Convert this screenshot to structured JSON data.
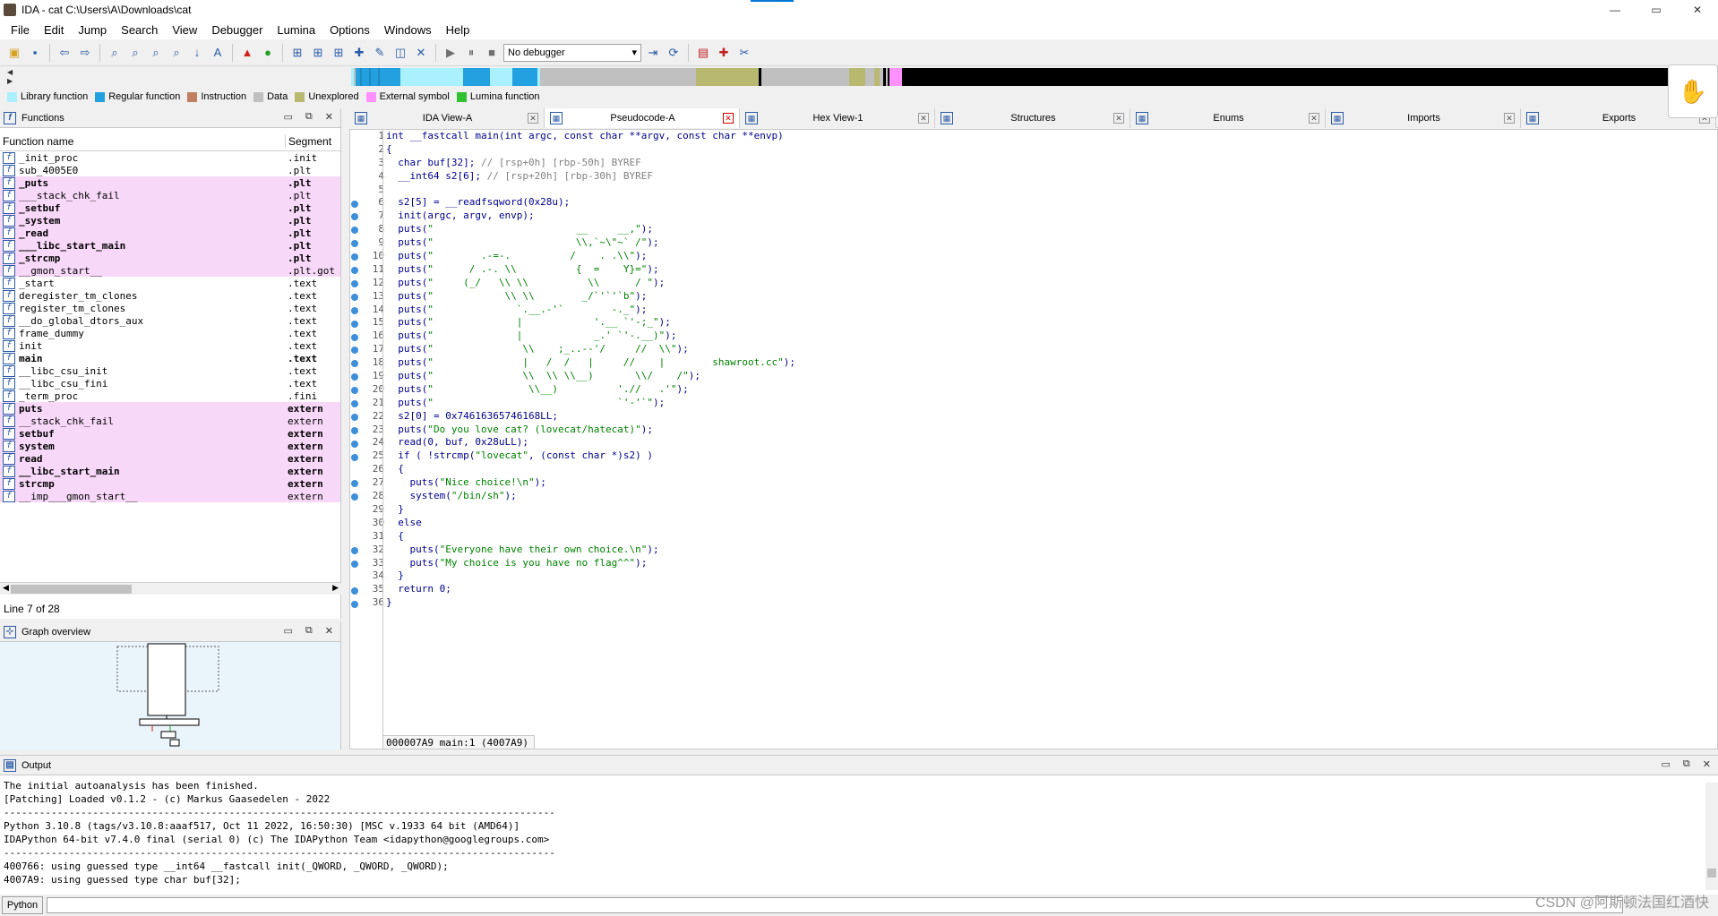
{
  "window": {
    "title": "IDA - cat C:\\Users\\A\\Downloads\\cat",
    "min": "—",
    "max": "▭",
    "close": "✕"
  },
  "menu": [
    "File",
    "Edit",
    "Jump",
    "Search",
    "View",
    "Debugger",
    "Lumina",
    "Options",
    "Windows",
    "Help"
  ],
  "toolbar": {
    "debugger_select": "No debugger"
  },
  "legend": [
    {
      "label": "Library function",
      "color": "#aaf0ff"
    },
    {
      "label": "Regular function",
      "color": "#22a0e0"
    },
    {
      "label": "Instruction",
      "color": "#c08060"
    },
    {
      "label": "Data",
      "color": "#c0c0c0"
    },
    {
      "label": "Unexplored",
      "color": "#b8b870"
    },
    {
      "label": "External symbol",
      "color": "#ff90ff"
    },
    {
      "label": "Lumina function",
      "color": "#30c030"
    }
  ],
  "functions_panel": {
    "title": "Functions",
    "col_name": "Function name",
    "col_segment": "Segment",
    "status": "Line 7 of 28",
    "rows": [
      {
        "name": "_init_proc",
        "seg": ".init",
        "lib": false,
        "bold": false
      },
      {
        "name": "sub_4005E0",
        "seg": ".plt",
        "lib": false,
        "bold": false
      },
      {
        "name": "_puts",
        "seg": ".plt",
        "lib": true,
        "bold": true
      },
      {
        "name": "___stack_chk_fail",
        "seg": ".plt",
        "lib": true,
        "bold": false
      },
      {
        "name": "_setbuf",
        "seg": ".plt",
        "lib": true,
        "bold": true
      },
      {
        "name": "_system",
        "seg": ".plt",
        "lib": true,
        "bold": true
      },
      {
        "name": "_read",
        "seg": ".plt",
        "lib": true,
        "bold": true
      },
      {
        "name": "___libc_start_main",
        "seg": ".plt",
        "lib": true,
        "bold": true
      },
      {
        "name": "_strcmp",
        "seg": ".plt",
        "lib": true,
        "bold": true
      },
      {
        "name": "__gmon_start__",
        "seg": ".plt.got",
        "lib": true,
        "bold": false
      },
      {
        "name": "_start",
        "seg": ".text",
        "lib": false,
        "bold": false
      },
      {
        "name": "deregister_tm_clones",
        "seg": ".text",
        "lib": false,
        "bold": false
      },
      {
        "name": "register_tm_clones",
        "seg": ".text",
        "lib": false,
        "bold": false
      },
      {
        "name": "__do_global_dtors_aux",
        "seg": ".text",
        "lib": false,
        "bold": false
      },
      {
        "name": "frame_dummy",
        "seg": ".text",
        "lib": false,
        "bold": false
      },
      {
        "name": "init",
        "seg": ".text",
        "lib": false,
        "bold": false
      },
      {
        "name": "main",
        "seg": ".text",
        "lib": false,
        "bold": true
      },
      {
        "name": "__libc_csu_init",
        "seg": ".text",
        "lib": false,
        "bold": false
      },
      {
        "name": "__libc_csu_fini",
        "seg": ".text",
        "lib": false,
        "bold": false
      },
      {
        "name": "_term_proc",
        "seg": ".fini",
        "lib": false,
        "bold": false
      },
      {
        "name": "puts",
        "seg": "extern",
        "lib": true,
        "bold": true
      },
      {
        "name": "__stack_chk_fail",
        "seg": "extern",
        "lib": true,
        "bold": false
      },
      {
        "name": "setbuf",
        "seg": "extern",
        "lib": true,
        "bold": true
      },
      {
        "name": "system",
        "seg": "extern",
        "lib": true,
        "bold": true
      },
      {
        "name": "read",
        "seg": "extern",
        "lib": true,
        "bold": true
      },
      {
        "name": "__libc_start_main",
        "seg": "extern",
        "lib": true,
        "bold": true
      },
      {
        "name": "strcmp",
        "seg": "extern",
        "lib": true,
        "bold": true
      },
      {
        "name": "__imp___gmon_start__",
        "seg": "extern",
        "lib": true,
        "bold": false
      }
    ]
  },
  "graph_panel": {
    "title": "Graph overview"
  },
  "tabs": [
    {
      "label": "IDA View-A",
      "icon": "ida-view-icon",
      "active": false
    },
    {
      "label": "Pseudocode-A",
      "icon": "pseudocode-icon",
      "active": true
    },
    {
      "label": "Hex View-1",
      "icon": "hex-view-icon",
      "active": false
    },
    {
      "label": "Structures",
      "icon": "structures-icon",
      "active": false
    },
    {
      "label": "Enums",
      "icon": "enums-icon",
      "active": false
    },
    {
      "label": "Imports",
      "icon": "imports-icon",
      "active": false
    },
    {
      "label": "Exports",
      "icon": "exports-icon",
      "active": false
    }
  ],
  "code": {
    "status": "000007A9 main:1 (4007A9)",
    "lines": [
      {
        "n": "1",
        "dot": false,
        "parts": [
          [
            "t",
            "int __fastcall main(int argc, const char **argv, const char **envp)"
          ]
        ]
      },
      {
        "n": "2",
        "dot": false,
        "parts": [
          [
            "t",
            "{"
          ]
        ]
      },
      {
        "n": "3",
        "dot": false,
        "parts": [
          [
            "t",
            "  char buf[32]; "
          ],
          [
            "g",
            "// [rsp+0h] [rbp-50h] BYREF"
          ]
        ]
      },
      {
        "n": "4",
        "dot": false,
        "parts": [
          [
            "t",
            "  __int64 s2[6]; "
          ],
          [
            "g",
            "// [rsp+20h] [rbp-30h] BYREF"
          ]
        ]
      },
      {
        "n": "5",
        "dot": false,
        "parts": [
          [
            "t",
            ""
          ]
        ]
      },
      {
        "n": "6",
        "dot": true,
        "parts": [
          [
            "t",
            "  s2[5] = __readfsqword(0x28u);"
          ]
        ]
      },
      {
        "n": "7",
        "dot": true,
        "parts": [
          [
            "t",
            "  init(argc, argv, envp);"
          ]
        ]
      },
      {
        "n": "8",
        "dot": true,
        "parts": [
          [
            "t",
            "  puts("
          ],
          [
            "s",
            "\"                        __     __,\""
          ],
          [
            "t",
            ");"
          ]
        ]
      },
      {
        "n": "9",
        "dot": true,
        "parts": [
          [
            "t",
            "  puts("
          ],
          [
            "s",
            "\"                        \\\\,`~\\\"~` /\""
          ],
          [
            "t",
            ");"
          ]
        ]
      },
      {
        "n": "10",
        "dot": true,
        "parts": [
          [
            "t",
            "  puts("
          ],
          [
            "s",
            "\"        .-=-.          /    . .\\\\\""
          ],
          [
            "t",
            ");"
          ]
        ]
      },
      {
        "n": "11",
        "dot": true,
        "parts": [
          [
            "t",
            "  puts("
          ],
          [
            "s",
            "\"      / .-. \\\\          {  =    Y}=\""
          ],
          [
            "t",
            ");"
          ]
        ]
      },
      {
        "n": "12",
        "dot": true,
        "parts": [
          [
            "t",
            "  puts("
          ],
          [
            "s",
            "\"     (_/   \\\\ \\\\          \\\\      / \""
          ],
          [
            "t",
            ");"
          ]
        ]
      },
      {
        "n": "13",
        "dot": true,
        "parts": [
          [
            "t",
            "  puts("
          ],
          [
            "s",
            "\"            \\\\ \\\\        _/`'`'`b\""
          ],
          [
            "t",
            ");"
          ]
        ]
      },
      {
        "n": "14",
        "dot": true,
        "parts": [
          [
            "t",
            "  puts("
          ],
          [
            "s",
            "\"              `.__.-'`        -._\""
          ],
          [
            "t",
            ");"
          ]
        ]
      },
      {
        "n": "15",
        "dot": true,
        "parts": [
          [
            "t",
            "  puts("
          ],
          [
            "s",
            "\"              |            '.__ `'-;_\""
          ],
          [
            "t",
            ");"
          ]
        ]
      },
      {
        "n": "16",
        "dot": true,
        "parts": [
          [
            "t",
            "  puts("
          ],
          [
            "s",
            "\"              |            _.' `'-.__)\""
          ],
          [
            "t",
            ");"
          ]
        ]
      },
      {
        "n": "17",
        "dot": true,
        "parts": [
          [
            "t",
            "  puts("
          ],
          [
            "s",
            "\"               \\\\    ;_..--'/     //  \\\\\""
          ],
          [
            "t",
            ");"
          ]
        ]
      },
      {
        "n": "18",
        "dot": true,
        "parts": [
          [
            "t",
            "  puts("
          ],
          [
            "s",
            "\"               |   /  /   |     //    |        shawroot.cc\""
          ],
          [
            "t",
            ");"
          ]
        ]
      },
      {
        "n": "19",
        "dot": true,
        "parts": [
          [
            "t",
            "  puts("
          ],
          [
            "s",
            "\"               \\\\  \\\\ \\\\__)       \\\\/    /\""
          ],
          [
            "t",
            ");"
          ]
        ]
      },
      {
        "n": "20",
        "dot": true,
        "parts": [
          [
            "t",
            "  puts("
          ],
          [
            "s",
            "\"                \\\\__)          './/   .'\""
          ],
          [
            "t",
            ");"
          ]
        ]
      },
      {
        "n": "21",
        "dot": true,
        "parts": [
          [
            "t",
            "  puts("
          ],
          [
            "s",
            "\"                               `'-'`\""
          ],
          [
            "t",
            ");"
          ]
        ]
      },
      {
        "n": "22",
        "dot": true,
        "parts": [
          [
            "t",
            "  s2[0] = 0x74616365746168LL;"
          ]
        ]
      },
      {
        "n": "23",
        "dot": true,
        "parts": [
          [
            "t",
            "  puts("
          ],
          [
            "s",
            "\"Do you love cat? (lovecat/hatecat)\""
          ],
          [
            "t",
            ");"
          ]
        ]
      },
      {
        "n": "24",
        "dot": true,
        "parts": [
          [
            "t",
            "  read(0, buf, 0x28uLL);"
          ]
        ]
      },
      {
        "n": "25",
        "dot": true,
        "parts": [
          [
            "t",
            "  if ( !strcmp("
          ],
          [
            "s",
            "\"lovecat\""
          ],
          [
            "t",
            ", (const char *)s2) )"
          ]
        ]
      },
      {
        "n": "26",
        "dot": false,
        "parts": [
          [
            "t",
            "  {"
          ]
        ]
      },
      {
        "n": "27",
        "dot": true,
        "parts": [
          [
            "t",
            "    puts("
          ],
          [
            "s",
            "\"Nice choice!\\n\""
          ],
          [
            "t",
            ");"
          ]
        ]
      },
      {
        "n": "28",
        "dot": true,
        "parts": [
          [
            "t",
            "    system("
          ],
          [
            "s",
            "\"/bin/sh\""
          ],
          [
            "t",
            ");"
          ]
        ]
      },
      {
        "n": "29",
        "dot": false,
        "parts": [
          [
            "t",
            "  }"
          ]
        ]
      },
      {
        "n": "30",
        "dot": false,
        "parts": [
          [
            "t",
            "  else"
          ]
        ]
      },
      {
        "n": "31",
        "dot": false,
        "parts": [
          [
            "t",
            "  {"
          ]
        ]
      },
      {
        "n": "32",
        "dot": true,
        "parts": [
          [
            "t",
            "    puts("
          ],
          [
            "s",
            "\"Everyone have their own choice.\\n\""
          ],
          [
            "t",
            ");"
          ]
        ]
      },
      {
        "n": "33",
        "dot": true,
        "parts": [
          [
            "t",
            "    puts("
          ],
          [
            "s",
            "\"My choice is you have no flag^^\""
          ],
          [
            "t",
            ");"
          ]
        ]
      },
      {
        "n": "34",
        "dot": false,
        "parts": [
          [
            "t",
            "  }"
          ]
        ]
      },
      {
        "n": "35",
        "dot": true,
        "parts": [
          [
            "t",
            "  return 0;"
          ]
        ]
      },
      {
        "n": "36",
        "dot": true,
        "parts": [
          [
            "t",
            "}"
          ]
        ]
      }
    ]
  },
  "output": {
    "title": "Output",
    "lines": [
      "The initial autoanalysis has been finished.",
      "[Patching] Loaded v0.1.2 - (c) Markus Gaasedelen - 2022",
      "---------------------------------------------------------------------------------------------",
      "Python 3.10.8 (tags/v3.10.8:aaaf517, Oct 11 2022, 16:50:30) [MSC v.1933 64 bit (AMD64)]",
      "IDAPython 64-bit v7.4.0 final (serial 0) (c) The IDAPython Team <idapython@googlegroups.com>",
      "---------------------------------------------------------------------------------------------",
      "400766: using guessed type __int64 __fastcall init(_QWORD, _QWORD, _QWORD);",
      "4007A9: using guessed type char buf[32];"
    ]
  },
  "cmdbar": {
    "lang": "Python"
  },
  "watermark": "CSDN @阿斯顿法国红酒快"
}
